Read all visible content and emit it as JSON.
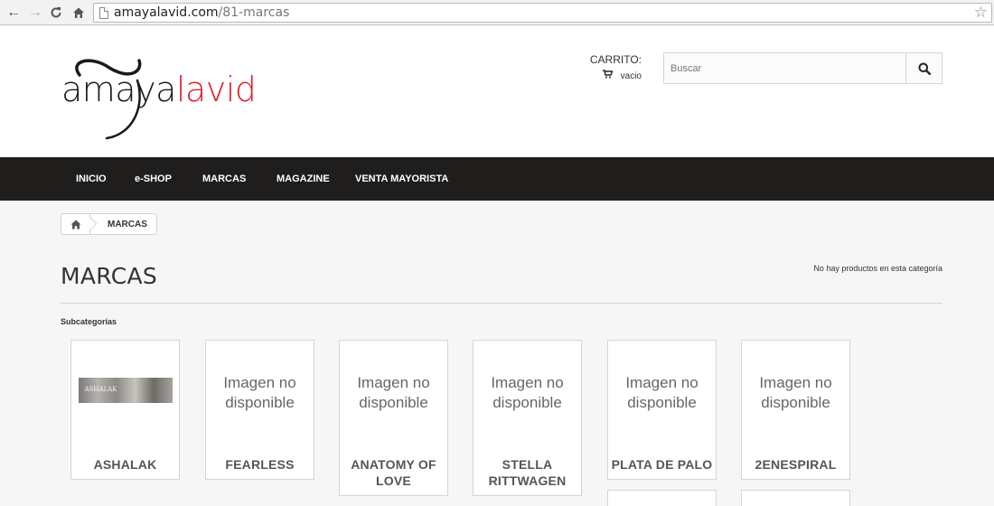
{
  "browser": {
    "url_domain": "amayalavid.com",
    "url_path": "/81-marcas"
  },
  "logo": {
    "part1": "amaya",
    "part2": "lavid"
  },
  "cart": {
    "label": "CARRITO:",
    "status": "vacio"
  },
  "search": {
    "placeholder": "Buscar"
  },
  "menu": {
    "items": [
      "INICIO",
      "e-SHOP",
      "MARCAS",
      "MAGAZINE",
      "VENTA MAYORISTA"
    ]
  },
  "breadcrumb": {
    "current": "MARCAS"
  },
  "page": {
    "title": "MARCAS",
    "no_products": "No hay productos en esta categoría",
    "subcategories_heading": "Subcategorías"
  },
  "subcategories": [
    {
      "name": "ASHALAK",
      "image_text": "",
      "thumb_text": "ASHALAK"
    },
    {
      "name": "FEARLESS",
      "image_text": "Imagen no disponible"
    },
    {
      "name": "ANATOMY OF LOVE",
      "image_text": "Imagen no disponible"
    },
    {
      "name": "STELLA RITTWAGEN",
      "image_text": "Imagen no disponible"
    },
    {
      "name": "PLATA DE PALO",
      "image_text": "Imagen no disponible"
    },
    {
      "name": "2ENESPIRAL",
      "image_text": "Imagen no disponible"
    }
  ],
  "colors": {
    "brand_red": "#d9222a",
    "menu_bg": "#1f1e1d",
    "page_bg": "#f6f6f6"
  }
}
